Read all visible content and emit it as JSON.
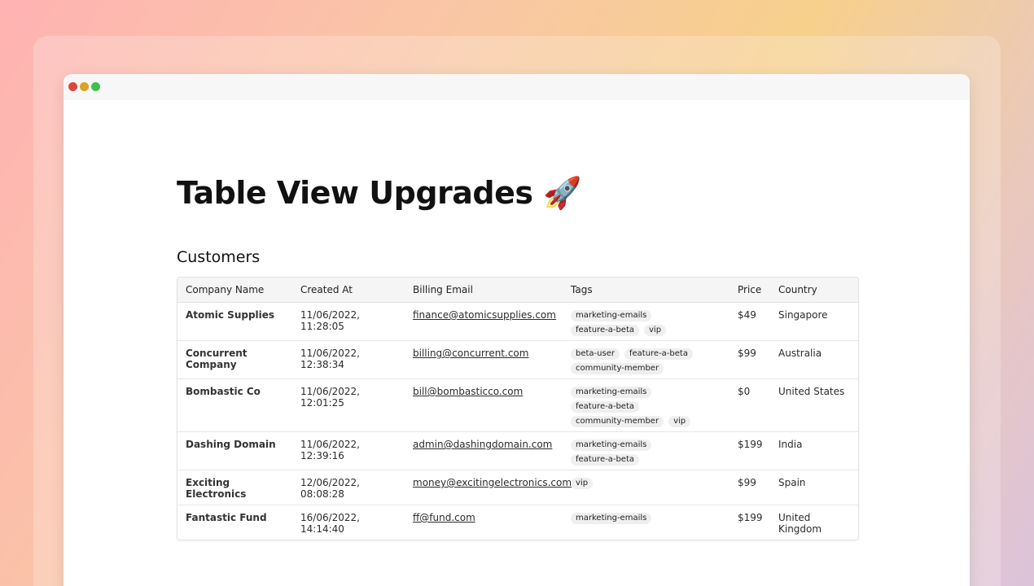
{
  "window": {
    "controls": [
      "close",
      "minimize",
      "maximize"
    ]
  },
  "page": {
    "title": "Table View Upgrades 🚀",
    "section_title": "Customers"
  },
  "table": {
    "columns": [
      "Company Name",
      "Created At",
      "Billing Email",
      "Tags",
      "Price",
      "Country"
    ],
    "rows": [
      {
        "company": "Atomic Supplies",
        "created_at": "11/06/2022, 11:28:05",
        "email": "finance@atomicsupplies.com",
        "tags": [
          "marketing-emails",
          "feature-a-beta",
          "vip"
        ],
        "price": "$49",
        "country": "Singapore"
      },
      {
        "company": "Concurrent Company",
        "created_at": "11/06/2022, 12:38:34",
        "email": "billing@concurrent.com",
        "tags": [
          "beta-user",
          "feature-a-beta",
          "community-member"
        ],
        "price": "$99",
        "country": "Australia"
      },
      {
        "company": "Bombastic Co",
        "created_at": "11/06/2022, 12:01:25",
        "email": "bill@bombasticco.com",
        "tags": [
          "marketing-emails",
          "feature-a-beta",
          "community-member",
          "vip"
        ],
        "price": "$0",
        "country": "United States"
      },
      {
        "company": "Dashing Domain",
        "created_at": "11/06/2022, 12:39:16",
        "email": "admin@dashingdomain.com",
        "tags": [
          "marketing-emails",
          "feature-a-beta"
        ],
        "price": "$199",
        "country": "India"
      },
      {
        "company": "Exciting Electronics",
        "created_at": "12/06/2022, 08:08:28",
        "email": "money@excitingelectronics.com",
        "tags": [
          "vip"
        ],
        "price": "$99",
        "country": "Spain"
      },
      {
        "company": "Fantastic Fund",
        "created_at": "16/06/2022, 14:14:40",
        "email": "ff@fund.com",
        "tags": [
          "marketing-emails"
        ],
        "price": "$199",
        "country": "United Kingdom"
      }
    ]
  }
}
